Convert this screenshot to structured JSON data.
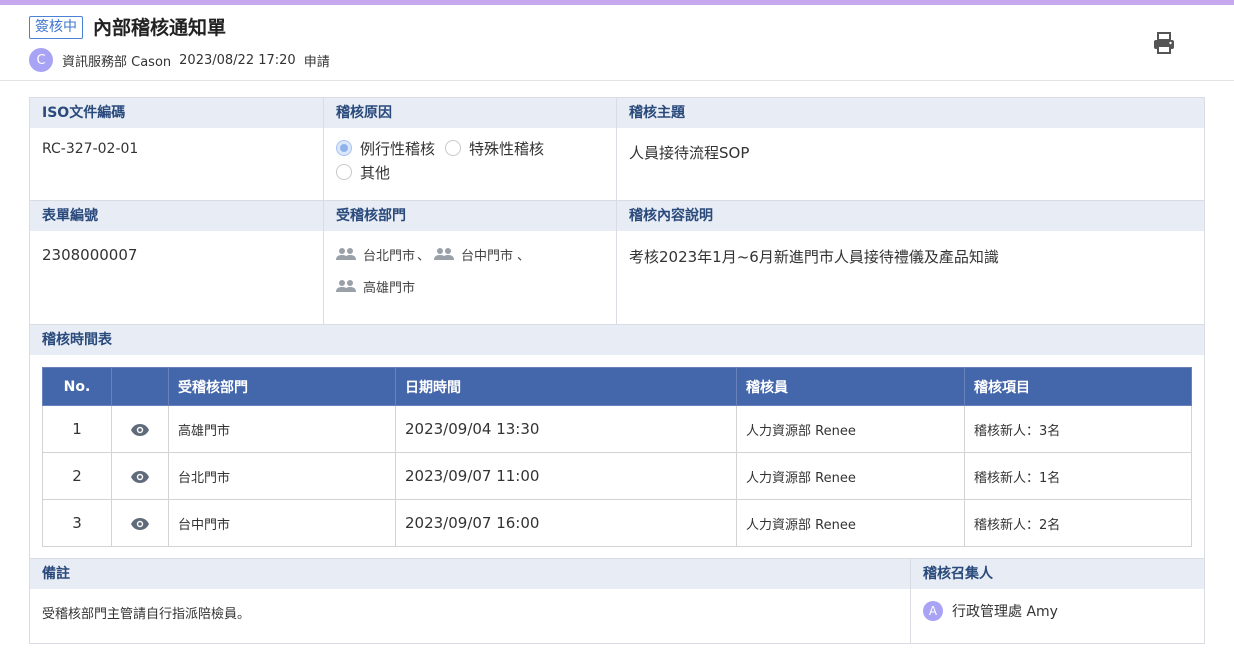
{
  "header": {
    "status": "簽核中",
    "title": "內部稽核通知單",
    "applicant_avatar": "C",
    "applicant": "資訊服務部 Cason",
    "datetime": "2023/08/22 17:20",
    "action": "申請",
    "accent": "#c6a8ee"
  },
  "form": {
    "iso": {
      "label": "ISO文件編碼",
      "value": "RC-327-02-01"
    },
    "reason": {
      "label": "稽核原因",
      "options": [
        {
          "text": "例行性稽核",
          "checked": true
        },
        {
          "text": "特殊性稽核",
          "checked": false
        },
        {
          "text": "其他",
          "checked": false
        }
      ]
    },
    "topic": {
      "label": "稽核主題",
      "value": "人員接待流程SOP"
    },
    "form_no": {
      "label": "表單編號",
      "value": "2308000007"
    },
    "departments": {
      "label": "受稽核部門",
      "items": [
        "台北門市",
        "台中門市",
        "高雄門市"
      ]
    },
    "description": {
      "label": "稽核內容說明",
      "value": "考核2023年1月~6月新進門市人員接待禮儀及產品知識"
    },
    "schedule": {
      "label": "稽核時間表",
      "headers": [
        "No.",
        "",
        "受稽核部門",
        "日期時間",
        "稽核員",
        "稽核項目"
      ],
      "rows": [
        {
          "no": "1",
          "dept": "高雄門市",
          "datetime": "2023/09/04 13:30",
          "auditor": "人力資源部 Renee",
          "item": "稽核新人：3名"
        },
        {
          "no": "2",
          "dept": "台北門市",
          "datetime": "2023/09/07 11:00",
          "auditor": "人力資源部 Renee",
          "item": "稽核新人：1名"
        },
        {
          "no": "3",
          "dept": "台中門市",
          "datetime": "2023/09/07 16:00",
          "auditor": "人力資源部 Renee",
          "item": "稽核新人：2名"
        }
      ]
    },
    "remark": {
      "label": "備註",
      "value": "受稽核部門主管請自行指派陪檢員。"
    },
    "convener": {
      "label": "稽核召集人",
      "avatar": "A",
      "value": "行政管理處 Amy"
    }
  }
}
